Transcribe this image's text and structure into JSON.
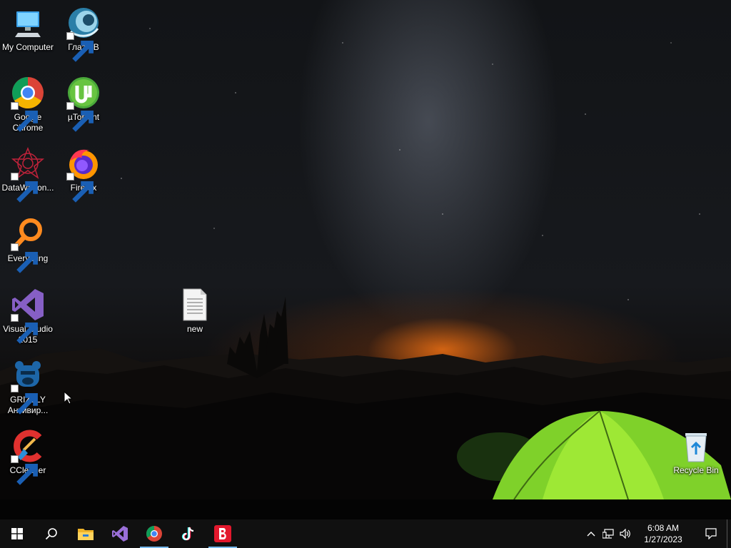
{
  "desktop_icons": {
    "my_computer": "My Computer",
    "glaz_tv": "Глаз.ТВ",
    "google_chrome": "Google Chrome",
    "utorrent": "µTorrent",
    "datawagon": "DataWagon...",
    "firefox": "Firefox",
    "everything": "Everything",
    "visual_studio": "Visual Studio 2015",
    "new_file": "new",
    "grizzly": "GRIZZLY Антивир...",
    "ccleaner": "CCleaner",
    "recycle_bin": "Recycle Bin"
  },
  "taskbar": {
    "start": "start-icon",
    "search": "search-icon",
    "pinned": [
      "file-explorer-icon",
      "visual-studio-icon",
      "chrome-icon",
      "tiktok-icon",
      "b-app-icon"
    ],
    "tray_icons": [
      "chevron-up-icon",
      "network-icon",
      "volume-icon"
    ],
    "time": "6:08 AM",
    "date": "1/27/2023"
  },
  "colors": {
    "taskbar_bg": "#101010",
    "running_indicator": "#76b9ed",
    "tent_green": "#7fd12a",
    "horizon_orange": "#ff7a14"
  }
}
